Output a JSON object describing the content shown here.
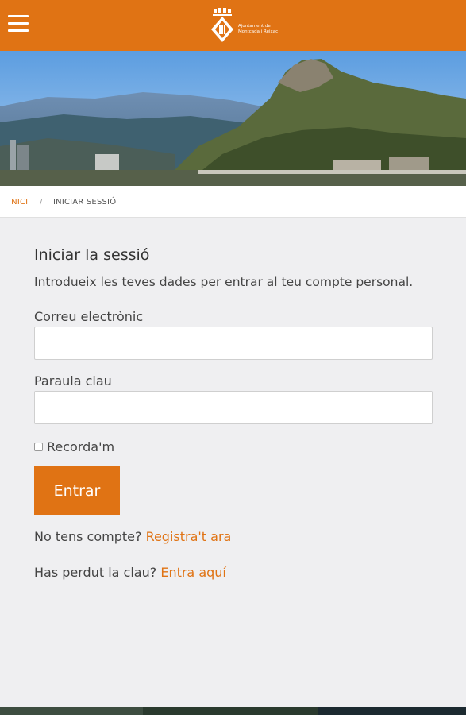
{
  "header": {
    "logo": {
      "line1": "Ajuntament de",
      "line2": "Montcada i Reixac"
    }
  },
  "breadcrumb": {
    "home": "INICI",
    "separator": "/",
    "current": "INICIAR SESSIÓ"
  },
  "login": {
    "title": "Iniciar la sessió",
    "intro": "Introdueix les teves dades per entrar al teu compte personal.",
    "email_label": "Correu electrònic",
    "email_value": "",
    "password_label": "Paraula clau",
    "password_value": "",
    "remember_label": "Recorda'm",
    "remember_checked": false,
    "submit_label": "Entrar",
    "no_account_text": "No tens compte?",
    "register_link": "Registra't ara",
    "lost_password_text": "Has perdut la clau?",
    "lost_password_link": "Entra aquí"
  },
  "colors": {
    "accent": "#e07314",
    "background": "#efeff1"
  },
  "icons": {
    "menu": "hamburger-menu-icon",
    "logo": "coat-of-arms-icon"
  }
}
